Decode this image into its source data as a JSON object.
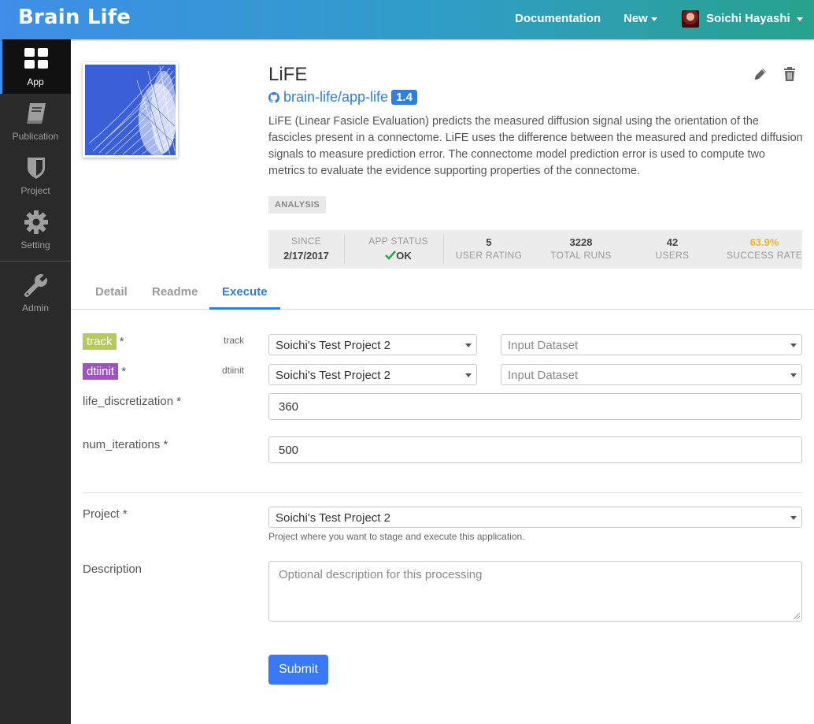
{
  "header": {
    "brand": "Brain Life",
    "nav": {
      "documentation": "Documentation",
      "new": "New",
      "user": "Soichi Hayashi"
    }
  },
  "sidebar": {
    "items": [
      {
        "label": "App",
        "icon": "grid-icon",
        "active": true
      },
      {
        "label": "Publication",
        "icon": "book-icon",
        "active": false
      },
      {
        "label": "Project",
        "icon": "shield-icon",
        "active": false
      },
      {
        "label": "Setting",
        "icon": "gear-icon",
        "active": false
      },
      {
        "label": "Admin",
        "icon": "wrench-icon",
        "active": false
      }
    ]
  },
  "app": {
    "name": "LiFE",
    "repo": "brain-life/app-life",
    "version": "1.4",
    "description": "LiFE (Linear Fasicle Evaluation) predicts the measured diffusion signal using the orientation of the fascicles present in a connectome. LiFE uses the difference between the measured and predicted diffusion signals to measure prediction error. The connectome model prediction error is used to compute two metrics to evaluate the evidence supporting properties of the connectome.",
    "tag": "ANALYSIS"
  },
  "stats": {
    "since_label": "SINCE",
    "since_value": "2/17/2017",
    "status_label": "APP STATUS",
    "status_value": "OK",
    "rating_value": "5",
    "rating_label": "USER RATING",
    "runs_value": "3228",
    "runs_label": "TOTAL RUNS",
    "users_value": "42",
    "users_label": "USERS",
    "success_value": "63.9%",
    "success_label": "SUCCESS RATE"
  },
  "tabs": [
    "Detail",
    "Readme",
    "Execute"
  ],
  "active_tab": "Execute",
  "form": {
    "inputs": [
      {
        "name": "track",
        "type": "track",
        "color": "#b5c95c",
        "project": "Soichi's Test Project 2",
        "dataset_placeholder": "Input Dataset"
      },
      {
        "name": "dtiinit",
        "type": "dtiinit",
        "color": "#a052c4",
        "project": "Soichi's Test Project 2",
        "dataset_placeholder": "Input Dataset"
      }
    ],
    "required_mark": "*",
    "config": [
      {
        "label": "life_discretization *",
        "value": "360"
      },
      {
        "label": "num_iterations *",
        "value": "500"
      }
    ],
    "project_label": "Project *",
    "project_value": "Soichi's Test Project 2",
    "project_hint": "Project where you want to stage and execute this application.",
    "description_label": "Description",
    "description_placeholder": "Optional description for this processing",
    "submit_label": "Submit"
  },
  "colors": {
    "accent": "#2f7fe0",
    "ok": "#2aa64a",
    "success_rate": "#f0b429",
    "sidebar": "#2a2a2a"
  }
}
